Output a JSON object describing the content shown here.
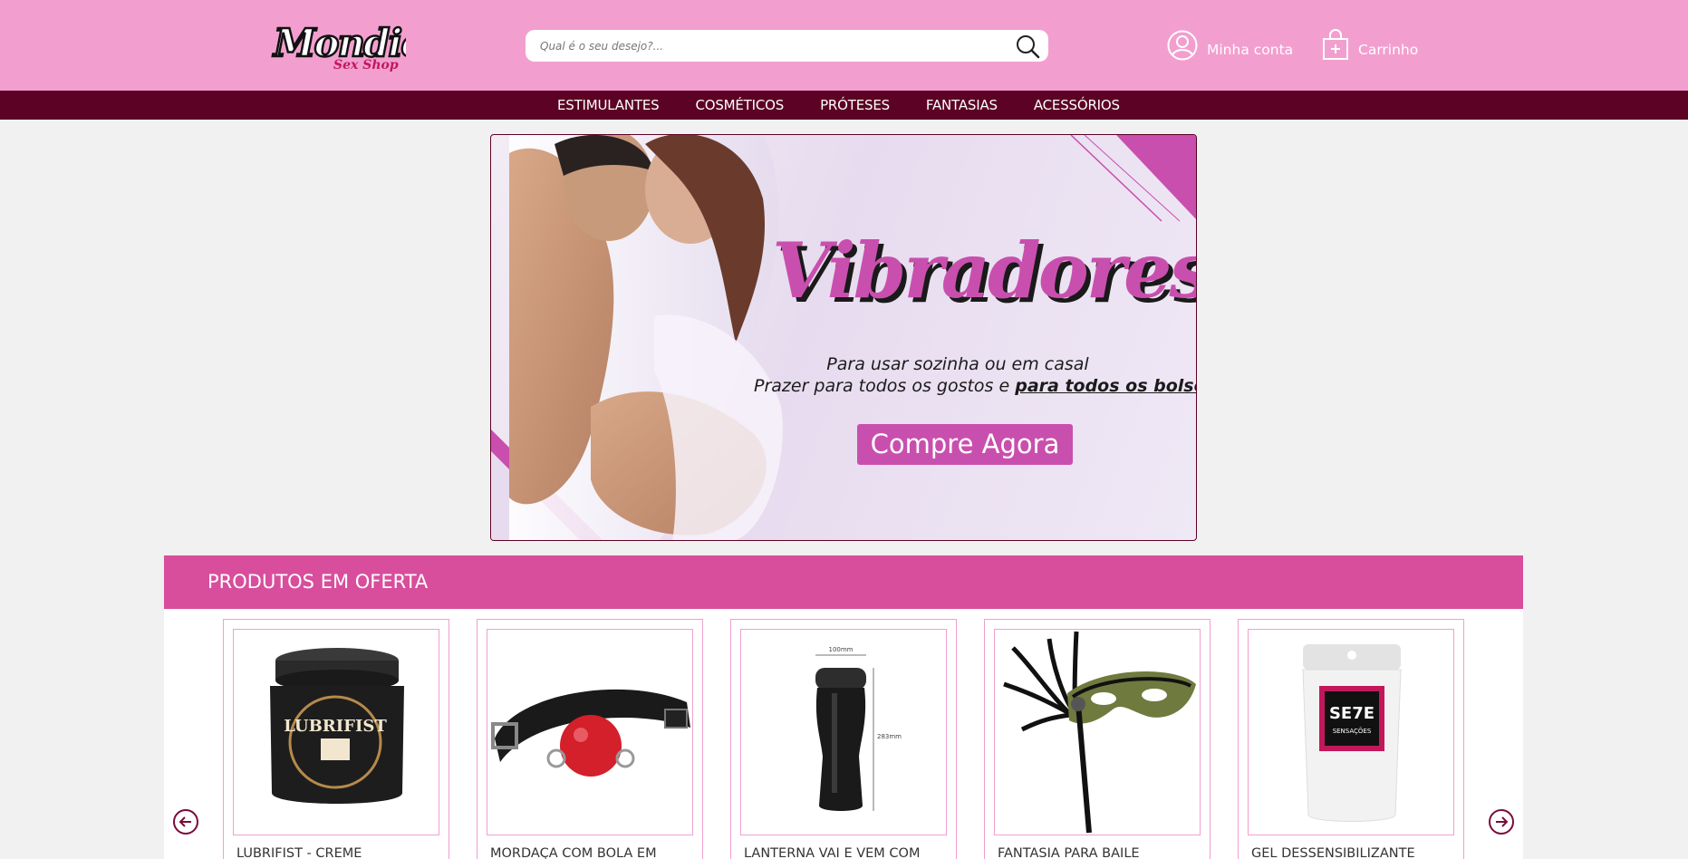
{
  "header": {
    "logo_text": "Mondie",
    "logo_subtitle": "Sex Shop",
    "search_placeholder": "Qual é o seu desejo?...",
    "account_label": "Minha conta",
    "cart_label": "Carrinho",
    "background_color": "#f29fcf"
  },
  "nav": {
    "items": [
      "ESTIMULANTES",
      "COSMÉTICOS",
      "PRÓTESES",
      "FANTASIAS",
      "ACESSÓRIOS"
    ],
    "background_color": "#5c0224"
  },
  "banner": {
    "title": "Vibradores",
    "line1": "Para usar sozinha ou em casal",
    "line2_start": "Prazer para todos os gostos e ",
    "line2_emphasis": "para todos os bolsos",
    "cta": "Compre Agora",
    "accent_color": "#c94fae"
  },
  "offers": {
    "heading": "PRODUTOS EM OFERTA",
    "bar_color": "#d84e9c",
    "products": [
      {
        "name": "LUBRIFIST - CREME",
        "image_text": "LUBRIFIST"
      },
      {
        "name": "MORDAÇA COM BOLA EM",
        "image_text": ""
      },
      {
        "name": "LANTERNA VAI E VEM COM",
        "image_text_top": "100mm",
        "image_text_side": "283mm"
      },
      {
        "name": "FANTASIA PARA BAILE",
        "image_text": ""
      },
      {
        "name": "GEL DESSENSIBILIZANTE",
        "image_text": "SE7E",
        "image_subtext": "SENSAÇÕES"
      }
    ]
  },
  "icons": {
    "search": "search-icon",
    "account": "user-icon",
    "cart": "shopping-bag-icon",
    "prev": "arrow-left-icon",
    "next": "arrow-right-icon"
  }
}
